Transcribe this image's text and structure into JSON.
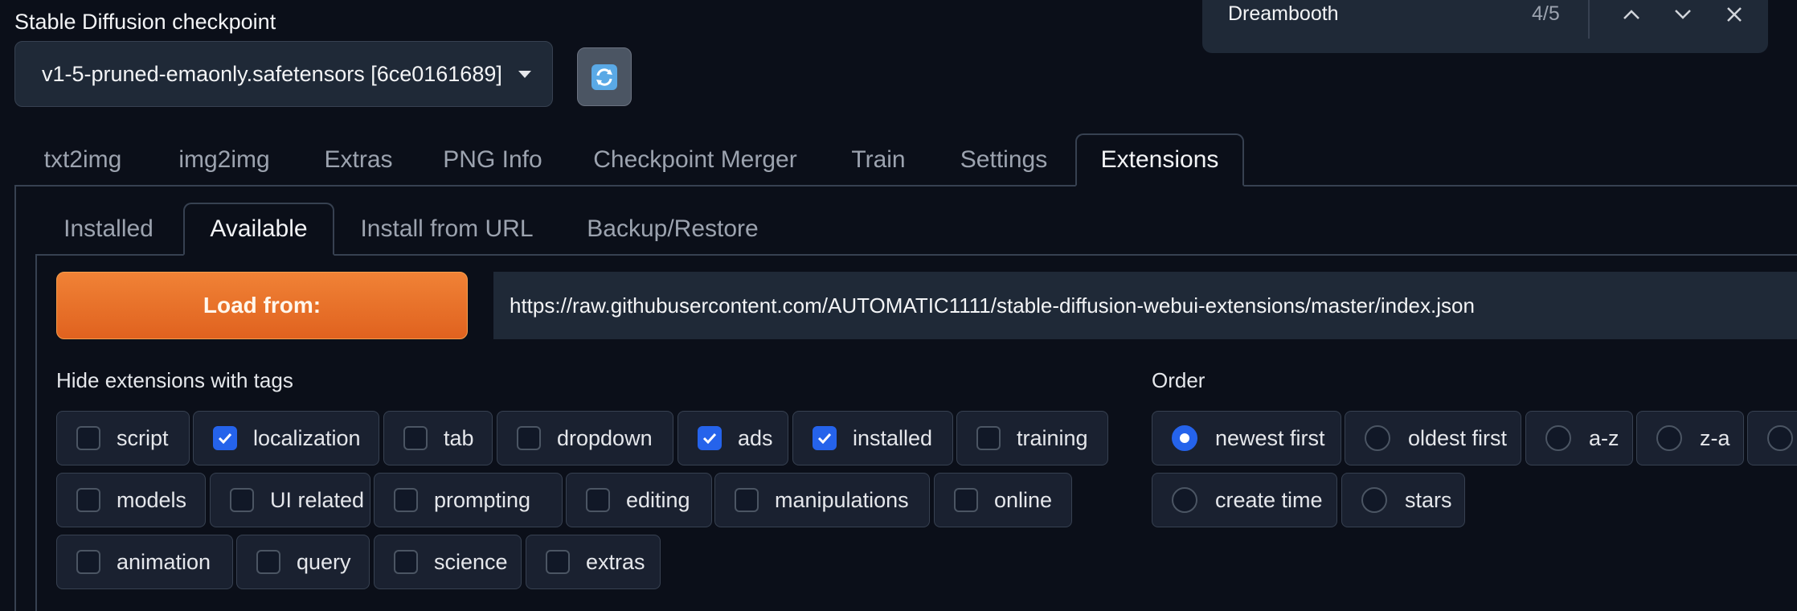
{
  "checkpoint": {
    "label": "Stable Diffusion checkpoint",
    "value": "v1-5-pruned-emaonly.safetensors [6ce0161689]"
  },
  "find_bar": {
    "query": "Dreambooth",
    "count": "4/5"
  },
  "main_tabs": [
    {
      "label": "txt2img",
      "active": false
    },
    {
      "label": "img2img",
      "active": false
    },
    {
      "label": "Extras",
      "active": false
    },
    {
      "label": "PNG Info",
      "active": false
    },
    {
      "label": "Checkpoint Merger",
      "active": false
    },
    {
      "label": "Train",
      "active": false
    },
    {
      "label": "Settings",
      "active": false
    },
    {
      "label": "Extensions",
      "active": true
    }
  ],
  "sub_tabs": [
    {
      "label": "Installed",
      "active": false
    },
    {
      "label": "Available",
      "active": true
    },
    {
      "label": "Install from URL",
      "active": false
    },
    {
      "label": "Backup/Restore",
      "active": false
    }
  ],
  "load": {
    "button_label": "Load from:",
    "url": "https://raw.githubusercontent.com/AUTOMATIC1111/stable-diffusion-webui-extensions/master/index.json"
  },
  "hide_tags": {
    "label": "Hide extensions with tags",
    "options": [
      {
        "label": "script",
        "checked": false
      },
      {
        "label": "localization",
        "checked": true
      },
      {
        "label": "tab",
        "checked": false
      },
      {
        "label": "dropdown",
        "checked": false
      },
      {
        "label": "ads",
        "checked": true
      },
      {
        "label": "installed",
        "checked": true
      },
      {
        "label": "training",
        "checked": false
      },
      {
        "label": "models",
        "checked": false
      },
      {
        "label": "UI related",
        "checked": false
      },
      {
        "label": "prompting",
        "checked": false
      },
      {
        "label": "editing",
        "checked": false
      },
      {
        "label": "manipulations",
        "checked": false
      },
      {
        "label": "online",
        "checked": false
      },
      {
        "label": "animation",
        "checked": false
      },
      {
        "label": "query",
        "checked": false
      },
      {
        "label": "science",
        "checked": false
      },
      {
        "label": "extras",
        "checked": false
      }
    ]
  },
  "order": {
    "label": "Order",
    "options": [
      {
        "label": "newest first",
        "selected": true
      },
      {
        "label": "oldest first",
        "selected": false
      },
      {
        "label": "a-z",
        "selected": false
      },
      {
        "label": "z-a",
        "selected": false
      },
      {
        "label": "",
        "selected": false
      },
      {
        "label": "create time",
        "selected": false
      },
      {
        "label": "stars",
        "selected": false
      }
    ]
  },
  "colors": {
    "background": "#0b0f19",
    "accent_orange": "#e8712a",
    "checkbox_blue": "#2563eb"
  }
}
